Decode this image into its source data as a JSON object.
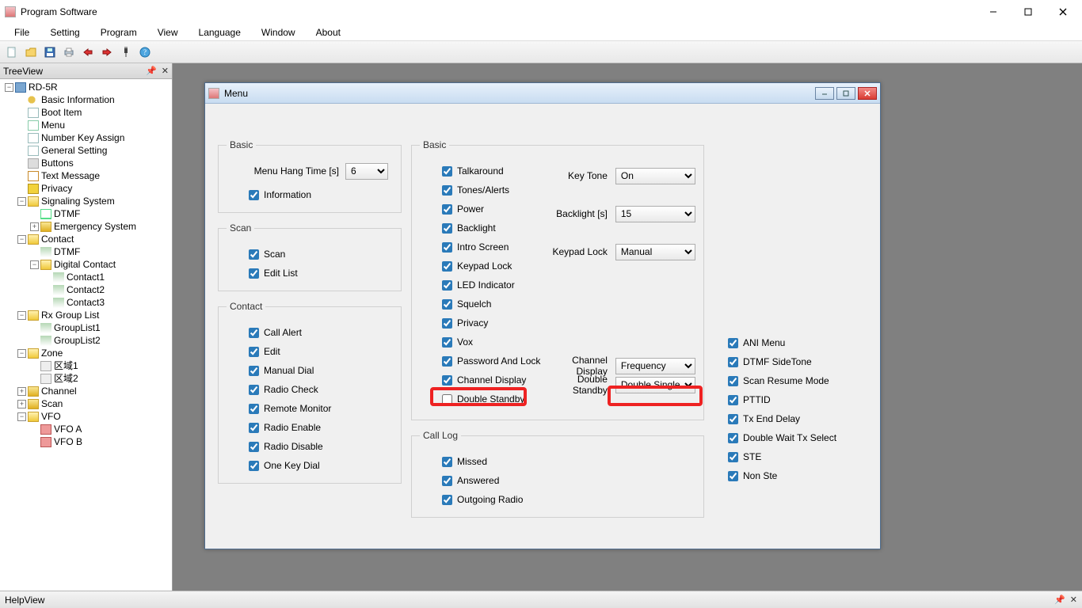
{
  "app": {
    "title": "Program Software",
    "treeview_title": "TreeView",
    "helpview_title": "HelpView"
  },
  "menubar": [
    "File",
    "Setting",
    "Program",
    "View",
    "Language",
    "Window",
    "About"
  ],
  "toolbar_icons": [
    "new-file-icon",
    "open-icon",
    "save-icon",
    "print-icon",
    "read-icon",
    "write-icon",
    "link-icon",
    "help-icon"
  ],
  "tree": [
    {
      "l": "RD-5R",
      "exp": "-",
      "icon": "ic-device",
      "depth": 0
    },
    {
      "l": "Basic Information",
      "icon": "ic-key",
      "depth": 1
    },
    {
      "l": "Boot Item",
      "icon": "ic-page",
      "depth": 1
    },
    {
      "l": "Menu",
      "icon": "ic-list",
      "depth": 1
    },
    {
      "l": "Number Key Assign",
      "icon": "ic-page",
      "depth": 1
    },
    {
      "l": "General Setting",
      "icon": "ic-page",
      "depth": 1
    },
    {
      "l": "Buttons",
      "icon": "ic-btn",
      "depth": 1
    },
    {
      "l": "Text Message",
      "icon": "ic-msg",
      "depth": 1
    },
    {
      "l": "Privacy",
      "icon": "ic-shield",
      "depth": 1
    },
    {
      "l": "Signaling System",
      "exp": "-",
      "icon": "ic-folder-o",
      "depth": 1
    },
    {
      "l": "DTMF",
      "icon": "ic-dtmf",
      "depth": 2
    },
    {
      "l": "Emergency System",
      "exp": "+",
      "icon": "ic-folder-c",
      "depth": 2
    },
    {
      "l": "Contact",
      "exp": "-",
      "icon": "ic-folder-o",
      "depth": 1
    },
    {
      "l": "DTMF",
      "icon": "ic-people",
      "depth": 2
    },
    {
      "l": "Digital Contact",
      "exp": "-",
      "icon": "ic-folder-o",
      "depth": 2
    },
    {
      "l": "Contact1",
      "icon": "ic-people",
      "depth": 3
    },
    {
      "l": "Contact2",
      "icon": "ic-people",
      "depth": 3
    },
    {
      "l": "Contact3",
      "icon": "ic-people",
      "depth": 3
    },
    {
      "l": "Rx Group List",
      "exp": "-",
      "icon": "ic-folder-o",
      "depth": 1
    },
    {
      "l": "GroupList1",
      "icon": "ic-people",
      "depth": 2
    },
    {
      "l": "GroupList2",
      "icon": "ic-people",
      "depth": 2
    },
    {
      "l": "Zone",
      "exp": "-",
      "icon": "ic-folder-o",
      "depth": 1
    },
    {
      "l": "区域1",
      "icon": "ic-zone",
      "depth": 2
    },
    {
      "l": "区域2",
      "icon": "ic-zone",
      "depth": 2
    },
    {
      "l": "Channel",
      "exp": "+",
      "icon": "ic-folder-c",
      "depth": 1
    },
    {
      "l": "Scan",
      "exp": "+",
      "icon": "ic-folder-c",
      "depth": 1
    },
    {
      "l": "VFO",
      "exp": "-",
      "icon": "ic-folder-o",
      "depth": 1
    },
    {
      "l": "VFO A",
      "icon": "ic-vfo",
      "depth": 2
    },
    {
      "l": "VFO B",
      "icon": "ic-vfo",
      "depth": 2
    }
  ],
  "inner": {
    "title": "Menu",
    "groups": {
      "basic_left": {
        "legend": "Basic",
        "hang_label": "Menu Hang Time [s]",
        "hang_value": "6",
        "information": "Information"
      },
      "scan": {
        "legend": "Scan",
        "items": [
          "Scan",
          "Edit List"
        ]
      },
      "contact": {
        "legend": "Contact",
        "items": [
          "Call Alert",
          "Edit",
          "Manual Dial",
          "Radio Check",
          "Remote Monitor",
          "Radio Enable",
          "Radio Disable",
          "One Key Dial"
        ]
      },
      "basic_mid": {
        "legend": "Basic",
        "checks": [
          "Talkaround",
          "Tones/Alerts",
          "Power",
          "Backlight",
          "Intro Screen",
          "Keypad Lock",
          "LED Indicator",
          "Squelch",
          "Privacy",
          "Vox",
          "Password And Lock",
          "Channel Display",
          "Double Standby"
        ],
        "selects": [
          {
            "label": "Key Tone",
            "value": "On"
          },
          {
            "label": "Backlight [s]",
            "value": "15"
          },
          {
            "label": "Keypad Lock",
            "value": "Manual"
          },
          {
            "label": "Channel Display",
            "value": "Frequency"
          },
          {
            "label": "Double Standby",
            "value": "Double Single"
          }
        ]
      },
      "call_log": {
        "legend": "Call Log",
        "items": [
          "Missed",
          "Answered",
          "Outgoing Radio"
        ]
      },
      "right_checks": [
        "ANI Menu",
        "DTMF SideTone",
        "Scan Resume Mode",
        "PTTID",
        "Tx End Delay",
        "Double Wait Tx Select",
        "STE",
        "Non Ste"
      ]
    }
  }
}
